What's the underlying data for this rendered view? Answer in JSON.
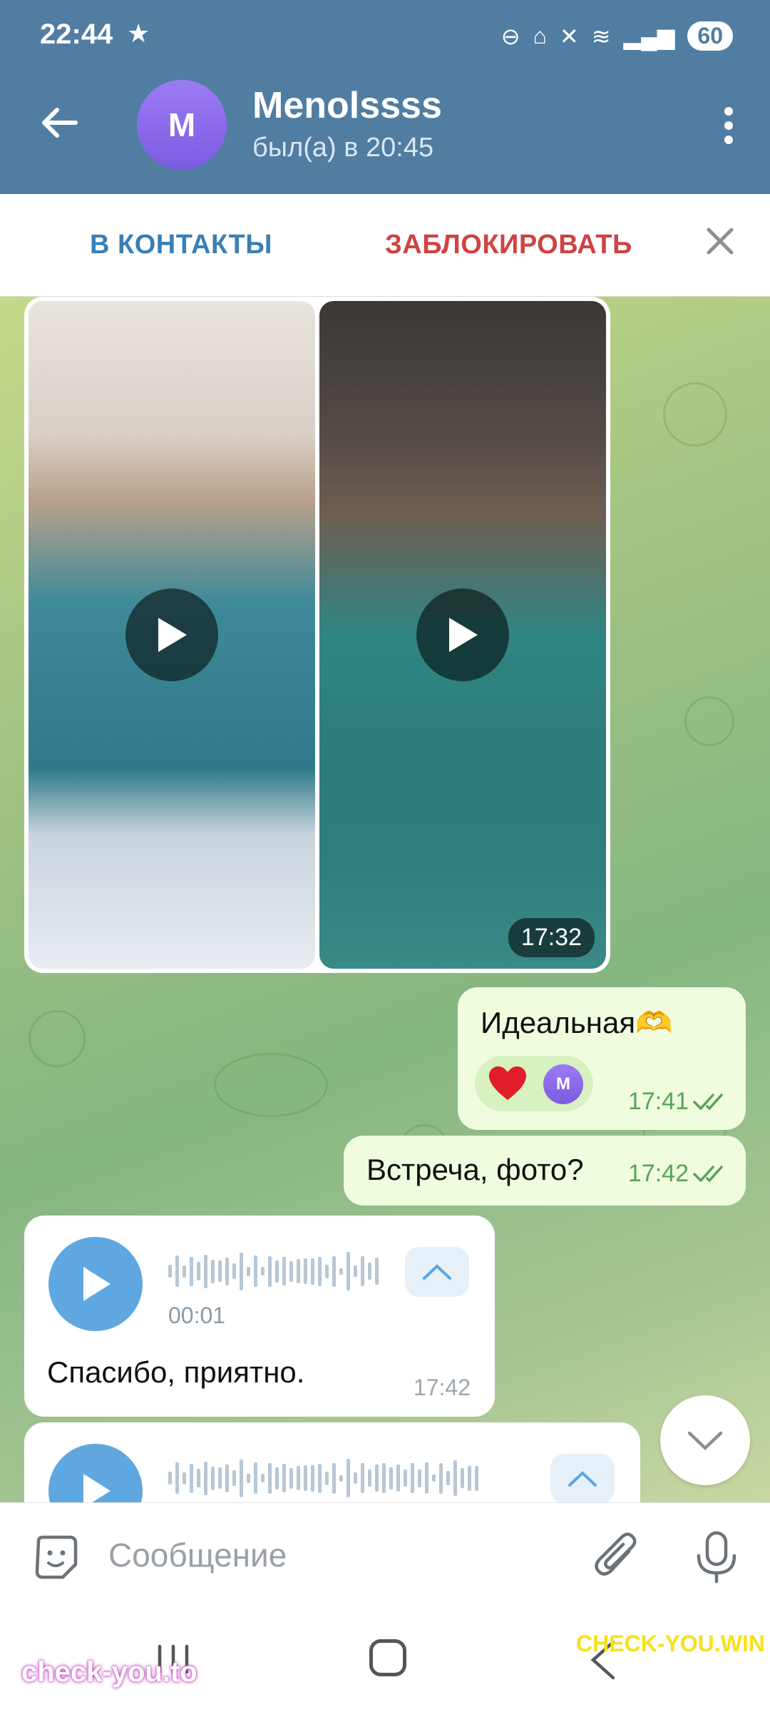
{
  "status_bar": {
    "time": "22:44",
    "battery": "60"
  },
  "header": {
    "avatar_letter": "M",
    "name": "Menolssss",
    "status": "был(а) в 20:45"
  },
  "action_bar": {
    "add_contact": "В КОНТАКТЫ",
    "block": "ЗАБЛОКИРОВАТЬ"
  },
  "album": {
    "duration": "17:32"
  },
  "messages": [
    {
      "text": "Идеальная🫶",
      "time": "17:41",
      "reaction_avatar": "M"
    },
    {
      "text": "Встреча, фото?",
      "time": "17:42"
    }
  ],
  "voice_messages": [
    {
      "duration": "00:01",
      "caption": "Спасибо, приятно.",
      "time": "17:42"
    }
  ],
  "input": {
    "placeholder": "Сообщение"
  },
  "watermarks": {
    "left": "check-you.to",
    "right": "CHECK-YOU.WIN"
  },
  "colors": {
    "header": "#517da2",
    "outgoing": "#effdde",
    "accent": "#5ea7e0",
    "block": "#cf4343"
  }
}
